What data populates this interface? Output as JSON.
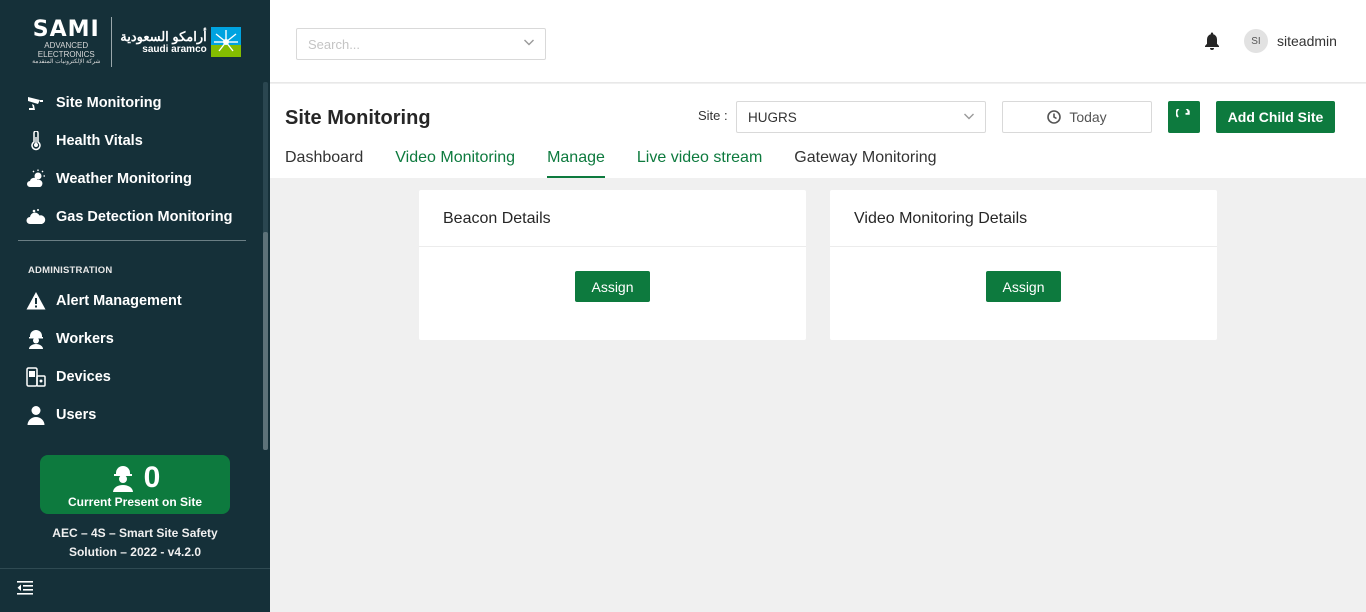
{
  "brand": {
    "sami_name": "SAMI",
    "sami_sub1": "ADVANCED",
    "sami_sub2": "ELECTRONICS",
    "sami_sub3": "شركة الإلكترونيات المتقدمة",
    "aramco_ar": "أرامكو السعودية",
    "aramco_en": "saudi aramco"
  },
  "sidebar": {
    "items": [
      {
        "label": "Site Monitoring",
        "icon": "cctv-icon"
      },
      {
        "label": "Health Vitals",
        "icon": "thermometer-icon"
      },
      {
        "label": "Weather Monitoring",
        "icon": "weather-icon"
      },
      {
        "label": "Gas Detection Monitoring",
        "icon": "gas-cloud-icon"
      }
    ],
    "section_label": "ADMINISTRATION",
    "admin_items": [
      {
        "label": "Alert Management",
        "icon": "warning-icon"
      },
      {
        "label": "Workers",
        "icon": "worker-icon"
      },
      {
        "label": "Devices",
        "icon": "devices-icon"
      },
      {
        "label": "Users",
        "icon": "user-icon"
      }
    ],
    "present_count": "0",
    "present_label": "Current Present on Site",
    "version_line1": "AEC – 4S – Smart Site Safety",
    "version_line2": "Solution – 2022 - v4.2.0"
  },
  "header": {
    "search_placeholder": "Search...",
    "avatar_initials": "SI",
    "username": "siteadmin"
  },
  "page": {
    "title": "Site Monitoring",
    "site_label": "Site :",
    "site_value": "HUGRS",
    "date_label": "Today",
    "add_child_label": "Add Child Site",
    "tabs": [
      {
        "label": "Dashboard",
        "active": false
      },
      {
        "label": "Video Monitoring",
        "active": false
      },
      {
        "label": "Manage",
        "active": true
      },
      {
        "label": "Live video stream",
        "active": false
      },
      {
        "label": "Gateway Monitoring",
        "active": false
      }
    ]
  },
  "cards": [
    {
      "title": "Beacon Details",
      "button": "Assign"
    },
    {
      "title": "Video Monitoring Details",
      "button": "Assign"
    }
  ],
  "colors": {
    "sidebar_bg": "#153039",
    "accent_green": "#0d7a3e",
    "content_bg": "#f0f0f0"
  }
}
